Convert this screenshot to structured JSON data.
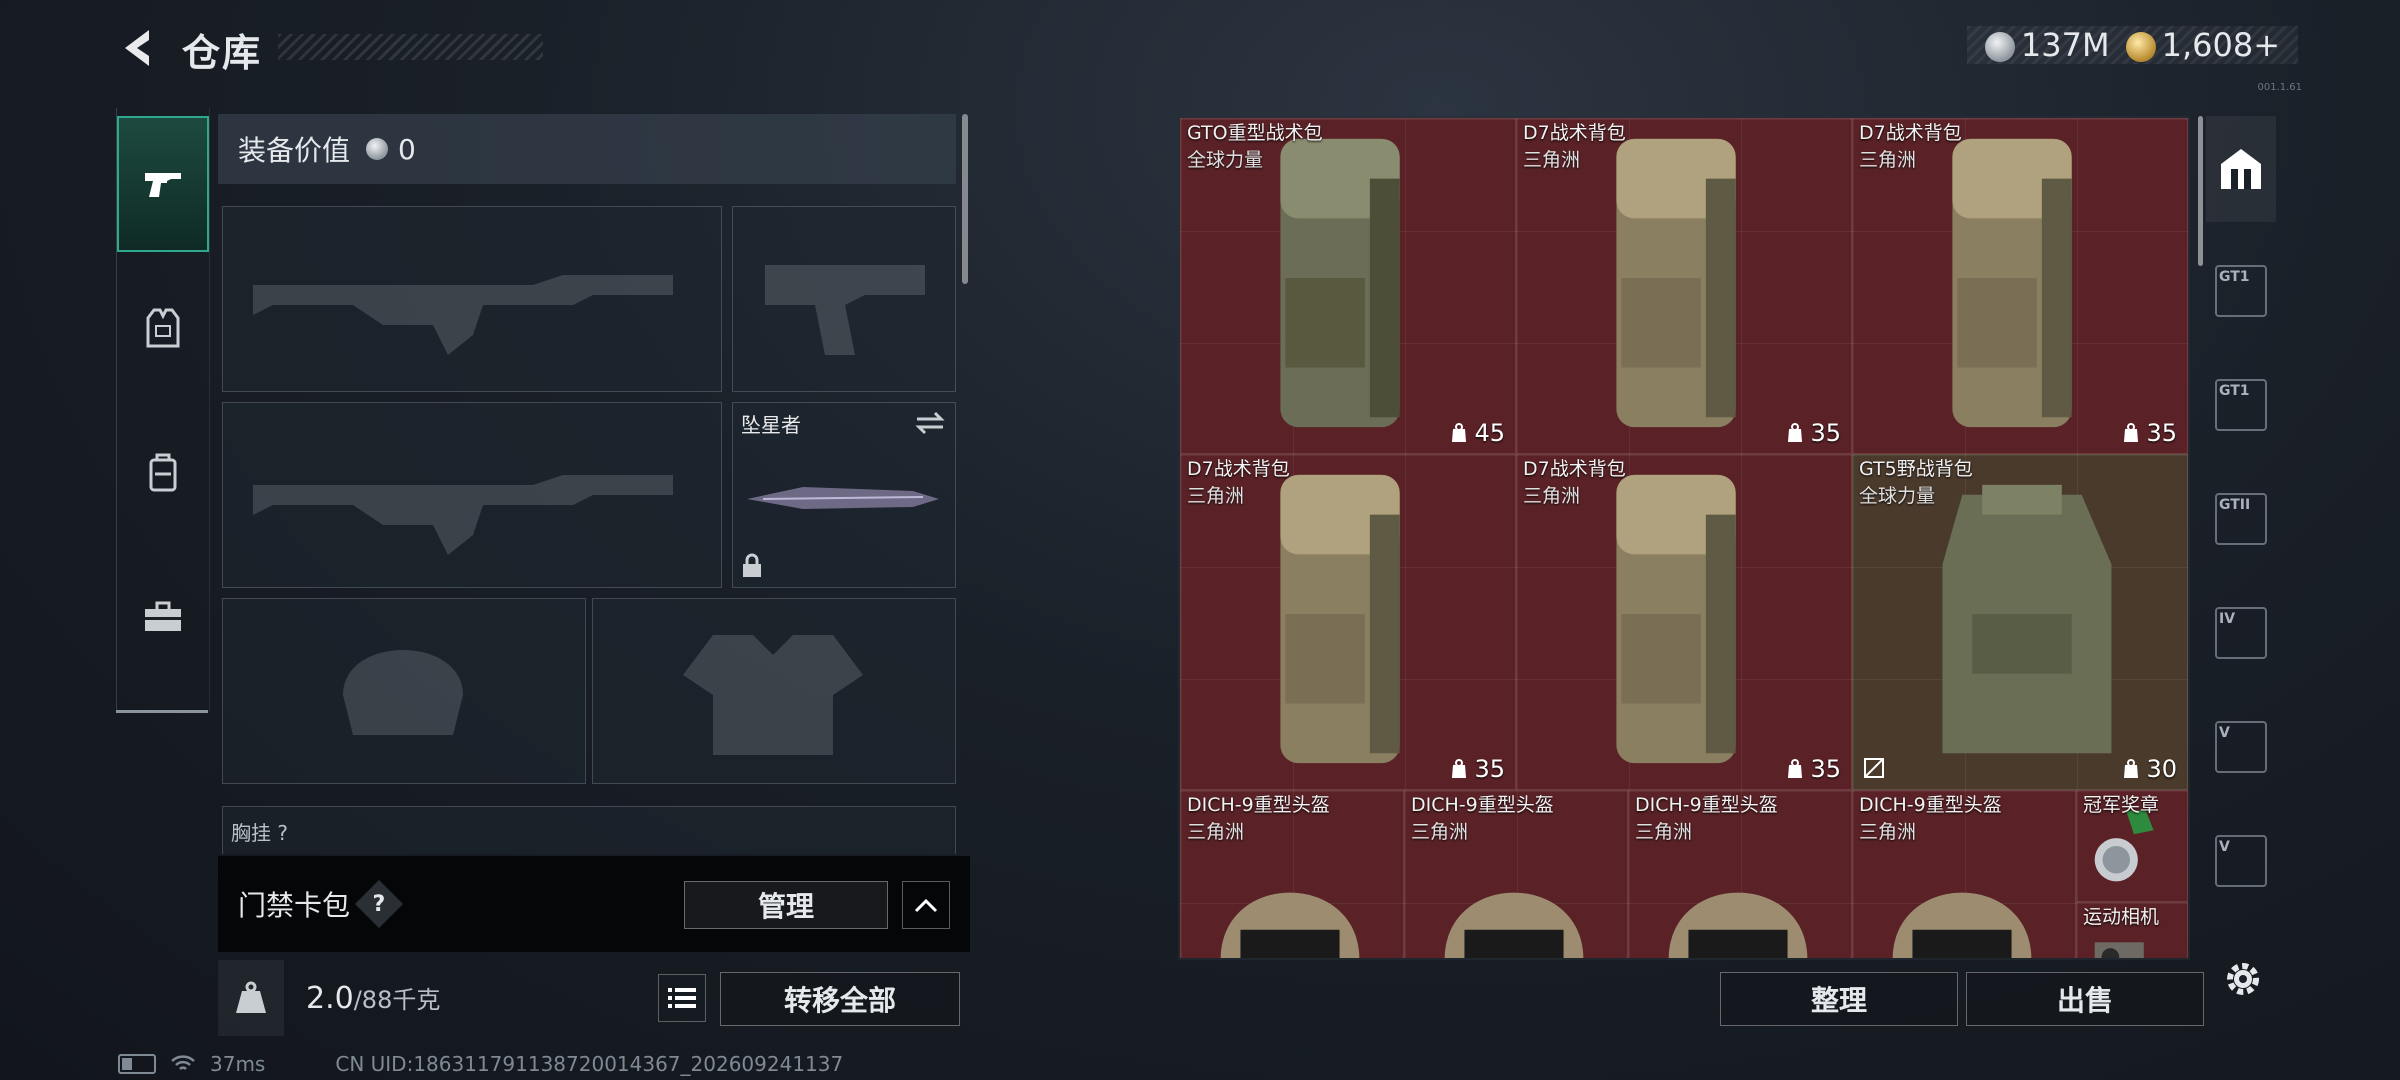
{
  "header": {
    "title": "仓库",
    "currency_silver": "137M",
    "currency_gold": "1,608",
    "add_label": "+",
    "version": "001.1.61"
  },
  "left_nav": {
    "items": [
      {
        "name": "weapons",
        "icon": "pistol-icon"
      },
      {
        "name": "armor",
        "icon": "vest-icon"
      },
      {
        "name": "backpack",
        "icon": "backpack-icon"
      },
      {
        "name": "tools",
        "icon": "toolbox-icon"
      }
    ]
  },
  "loadout": {
    "equip_value_label": "装备价值",
    "equip_value": "0",
    "melee_name": "坠星者",
    "chest_rig_label": "胸挂",
    "chest_rig_count": "?"
  },
  "card_pack": {
    "label": "门禁卡包",
    "help": "?",
    "manage_label": "管理"
  },
  "weight": {
    "current": "2.0",
    "max": "/88千克",
    "transfer_all_label": "转移全部"
  },
  "status_bar": {
    "ping": "37ms",
    "uid": "CN UID:1863117911387200143​67_202609241137"
  },
  "stash": {
    "sort_label": "整理",
    "sell_label": "出售",
    "items": [
      {
        "name": "GTO重型战术包",
        "source": "全球力量",
        "capacity": "45",
        "color": "red"
      },
      {
        "name": "D7战术背包",
        "source": "三角洲",
        "capacity": "35",
        "color": "red"
      },
      {
        "name": "D7战术背包",
        "source": "三角洲",
        "capacity": "35",
        "color": "red"
      },
      {
        "name": "D7战术背包",
        "source": "三角洲",
        "capacity": "35",
        "color": "red"
      },
      {
        "name": "D7战术背包",
        "source": "三角洲",
        "capacity": "35",
        "color": "red"
      },
      {
        "name": "GT5野战背包",
        "source": "全球力量",
        "capacity": "30",
        "color": "olive"
      },
      {
        "name": "DICH-9重型头盔",
        "source": "三角洲",
        "capacity": "",
        "color": "red"
      },
      {
        "name": "DICH-9重型头盔",
        "source": "三角洲",
        "capacity": "",
        "color": "red"
      },
      {
        "name": "DICH-9重型头盔",
        "source": "三角洲",
        "capacity": "",
        "color": "red"
      },
      {
        "name": "DICH-9重型头盔",
        "source": "三角洲",
        "capacity": "",
        "color": "red"
      },
      {
        "name": "冠军奖章",
        "source": "",
        "capacity": "",
        "color": "red"
      },
      {
        "name": "运动相机",
        "source": "",
        "capacity": "",
        "color": "red"
      }
    ]
  },
  "right_nav": {
    "tabs": [
      "GT1",
      "GT1",
      "GTII",
      "IV",
      "V",
      "V"
    ]
  }
}
